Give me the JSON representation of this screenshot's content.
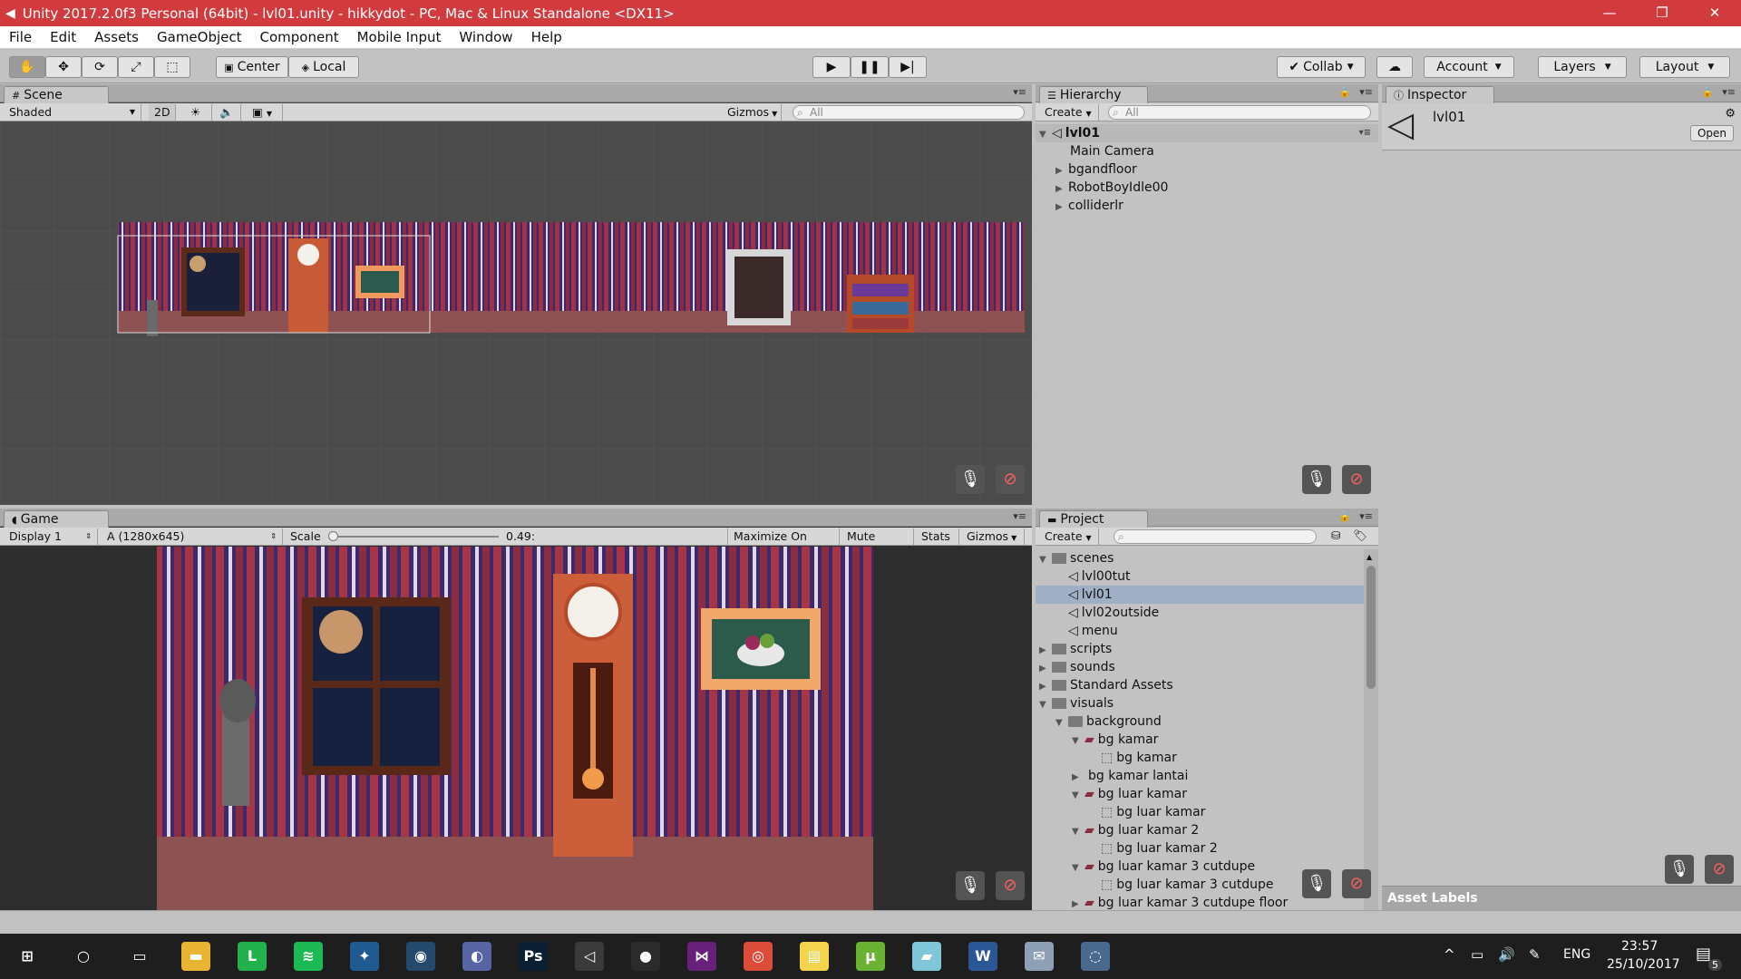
{
  "window": {
    "title": "Unity 2017.2.0f3 Personal (64bit) - lvl01.unity - hikkydot - PC, Mac & Linux Standalone <DX11>",
    "minimize": "—",
    "maximize": "❐",
    "close": "✕"
  },
  "menu": [
    "File",
    "Edit",
    "Assets",
    "GameObject",
    "Component",
    "Mobile Input",
    "Window",
    "Help"
  ],
  "toolbar": {
    "pivot": "Center",
    "space": "Local",
    "collab": "Collab",
    "account": "Account",
    "layers": "Layers",
    "layout": "Layout"
  },
  "scene": {
    "tab": "Scene",
    "shading": "Shaded",
    "mode2d": "2D",
    "gizmos": "Gizmos",
    "search_placeholder": "All"
  },
  "game": {
    "tab": "Game",
    "display": "Display 1",
    "resolution": "A (1280x645)",
    "scale_label": "Scale",
    "scale_value": "0.49:",
    "maximize": "Maximize On Play",
    "mute": "Mute Audio",
    "stats": "Stats",
    "gizmos": "Gizmos"
  },
  "hierarchy": {
    "tab": "Hierarchy",
    "create": "Create",
    "search_placeholder": "All",
    "scene_name": "lvl01",
    "items": [
      "Main Camera",
      "bgandfloor",
      "RobotBoyIdle00",
      "colliderlr"
    ]
  },
  "inspector": {
    "tab": "Inspector",
    "object": "lvl01",
    "open": "Open"
  },
  "project": {
    "tab": "Project",
    "create": "Create",
    "asset_labels": "Asset Labels",
    "tree": [
      {
        "label": "scenes",
        "kind": "folder",
        "depth": 0,
        "arrow": "▼"
      },
      {
        "label": "lvl00tut",
        "kind": "unity",
        "depth": 1,
        "arrow": ""
      },
      {
        "label": "lvl01",
        "kind": "unity",
        "depth": 1,
        "arrow": "",
        "selected": true
      },
      {
        "label": "lvl02outside",
        "kind": "unity",
        "depth": 1,
        "arrow": ""
      },
      {
        "label": "menu",
        "kind": "unity",
        "depth": 1,
        "arrow": ""
      },
      {
        "label": "scripts",
        "kind": "folder",
        "depth": 0,
        "arrow": "▶"
      },
      {
        "label": "sounds",
        "kind": "folder",
        "depth": 0,
        "arrow": "▶"
      },
      {
        "label": "Standard Assets",
        "kind": "folder",
        "depth": 0,
        "arrow": "▶"
      },
      {
        "label": "visuals",
        "kind": "folder",
        "depth": 0,
        "arrow": "▼"
      },
      {
        "label": "background",
        "kind": "folder",
        "depth": 1,
        "arrow": "▼"
      },
      {
        "label": "bg kamar",
        "kind": "image",
        "depth": 2,
        "arrow": "▼"
      },
      {
        "label": "bg kamar",
        "kind": "sprite",
        "depth": 3,
        "arrow": ""
      },
      {
        "label": "bg kamar lantai",
        "kind": "none",
        "depth": 2,
        "arrow": "▶"
      },
      {
        "label": "bg luar kamar",
        "kind": "image",
        "depth": 2,
        "arrow": "▼"
      },
      {
        "label": "bg luar kamar",
        "kind": "sprite",
        "depth": 3,
        "arrow": ""
      },
      {
        "label": "bg luar kamar 2",
        "kind": "image",
        "depth": 2,
        "arrow": "▼"
      },
      {
        "label": "bg luar kamar 2",
        "kind": "sprite",
        "depth": 3,
        "arrow": ""
      },
      {
        "label": "bg luar kamar 3 cutdupe",
        "kind": "image",
        "depth": 2,
        "arrow": "▼"
      },
      {
        "label": "bg luar kamar 3 cutdupe",
        "kind": "sprite",
        "depth": 3,
        "arrow": ""
      },
      {
        "label": "bg luar kamar 3 cutdupe floor",
        "kind": "image",
        "depth": 2,
        "arrow": "▶"
      }
    ]
  },
  "taskbar": {
    "lang": "ENG",
    "time": "23:57",
    "date": "25/10/2017",
    "notifications": "5",
    "apps": [
      {
        "name": "windows-start-icon",
        "glyph": "⊞",
        "color": "#1e1e1e"
      },
      {
        "name": "search-icon",
        "glyph": "○",
        "color": "#1e1e1e"
      },
      {
        "name": "task-view-icon",
        "glyph": "▭",
        "color": "#1e1e1e"
      },
      {
        "name": "file-explorer-icon",
        "glyph": "▬",
        "color": "#e8b431"
      },
      {
        "name": "line-icon",
        "glyph": "L",
        "color": "#22b14c"
      },
      {
        "name": "spotify-icon",
        "glyph": "≋",
        "color": "#1db954"
      },
      {
        "name": "krita-icon",
        "glyph": "✦",
        "color": "#1f5a91"
      },
      {
        "name": "steam-icon",
        "glyph": "◉",
        "color": "#234a6d"
      },
      {
        "name": "discord-icon",
        "glyph": "◐",
        "color": "#5865a5"
      },
      {
        "name": "photoshop-icon",
        "glyph": "Ps",
        "color": "#0b1f34"
      },
      {
        "name": "unity-icon",
        "glyph": "◁",
        "color": "#3a3a3a"
      },
      {
        "name": "github-icon",
        "glyph": "●",
        "color": "#2b2b2b"
      },
      {
        "name": "visual-studio-icon",
        "glyph": "⋈",
        "color": "#68217a"
      },
      {
        "name": "chrome-icon",
        "glyph": "◎",
        "color": "#dd4b39"
      },
      {
        "name": "sticky-notes-icon",
        "glyph": "▤",
        "color": "#f4d44a"
      },
      {
        "name": "utorrent-icon",
        "glyph": "µ",
        "color": "#6ab232"
      },
      {
        "name": "paint-icon",
        "glyph": "▰",
        "color": "#7fc6d9"
      },
      {
        "name": "word-icon",
        "glyph": "W",
        "color": "#2b5797"
      },
      {
        "name": "mail-icon",
        "glyph": "✉",
        "color": "#8da0b6"
      },
      {
        "name": "misc-app-icon",
        "glyph": "◌",
        "color": "#4a6a8d"
      }
    ]
  }
}
